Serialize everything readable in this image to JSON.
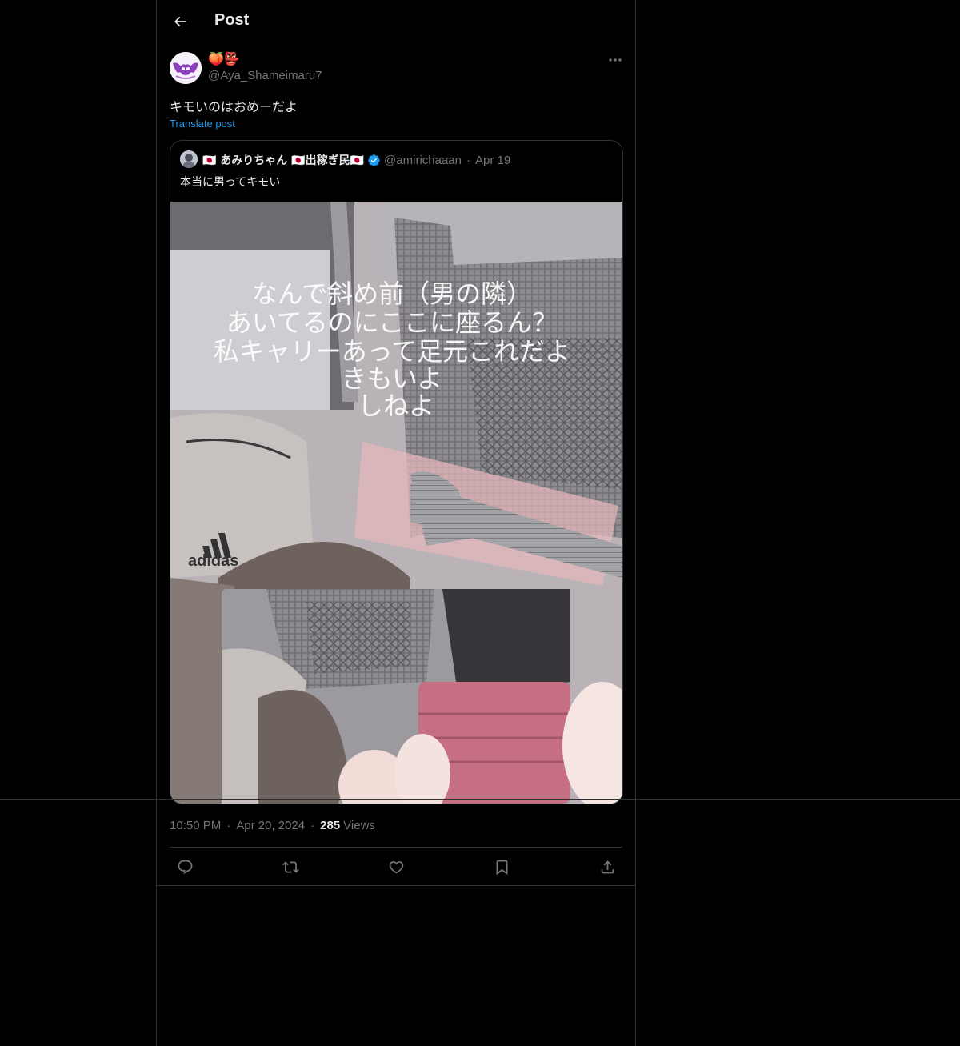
{
  "header": {
    "title": "Post",
    "back_icon": "arrow-left-icon"
  },
  "author": {
    "display_name_emoji": "🍑👺",
    "handle": "@Aya_Shameimaru7",
    "avatar_icon": "purple-bat-avatar"
  },
  "post": {
    "text": "キモいのはおめーだよ",
    "translate_label": "Translate post"
  },
  "quote": {
    "display_name": "🇯🇵 あみりちゃん 🇯🇵出稼ぎ民🇯🇵",
    "handle": "@amirichaaan",
    "date": "Apr 19",
    "text": "本当に男ってキモい",
    "image_overlay_text": "なんで斜め前（男の隣）\nあいてるのにここに座るん？\n私キャリーあって足元これだよ\nきもいよ\nしねよ",
    "image_brand_text": "adidas"
  },
  "meta": {
    "time": "10:50 PM",
    "date": "Apr 20, 2024",
    "views_count": "285",
    "views_label": "Views"
  },
  "actions": {
    "reply_icon": "reply-icon",
    "repost_icon": "repost-icon",
    "like_icon": "heart-icon",
    "bookmark_icon": "bookmark-icon",
    "share_icon": "share-icon"
  },
  "colors": {
    "background": "#000000",
    "text": "#e7e9ea",
    "muted": "#71767b",
    "link": "#1d9bf0",
    "border": "#2f3336"
  }
}
